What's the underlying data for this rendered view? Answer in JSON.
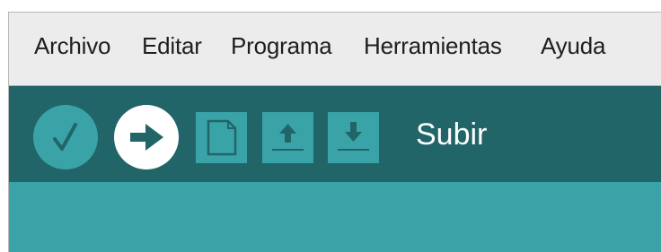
{
  "menubar": {
    "items": [
      {
        "label": "Archivo"
      },
      {
        "label": "Editar"
      },
      {
        "label": "Programa"
      },
      {
        "label": "Herramientas"
      },
      {
        "label": "Ayuda"
      }
    ]
  },
  "toolbar": {
    "buttons": [
      {
        "name": "verify",
        "icon": "checkmark-icon"
      },
      {
        "name": "upload",
        "icon": "arrow-right-icon"
      },
      {
        "name": "new",
        "icon": "new-file-icon"
      },
      {
        "name": "open",
        "icon": "upload-arrow-icon"
      },
      {
        "name": "save",
        "icon": "download-arrow-icon"
      }
    ],
    "status_label": "Subir"
  },
  "colors": {
    "menubar_bg": "#ececec",
    "toolbar_bg": "#216569",
    "content_bg": "#39a3a8",
    "button_bg": "#39a3a8",
    "active_button_bg": "#ffffff"
  }
}
